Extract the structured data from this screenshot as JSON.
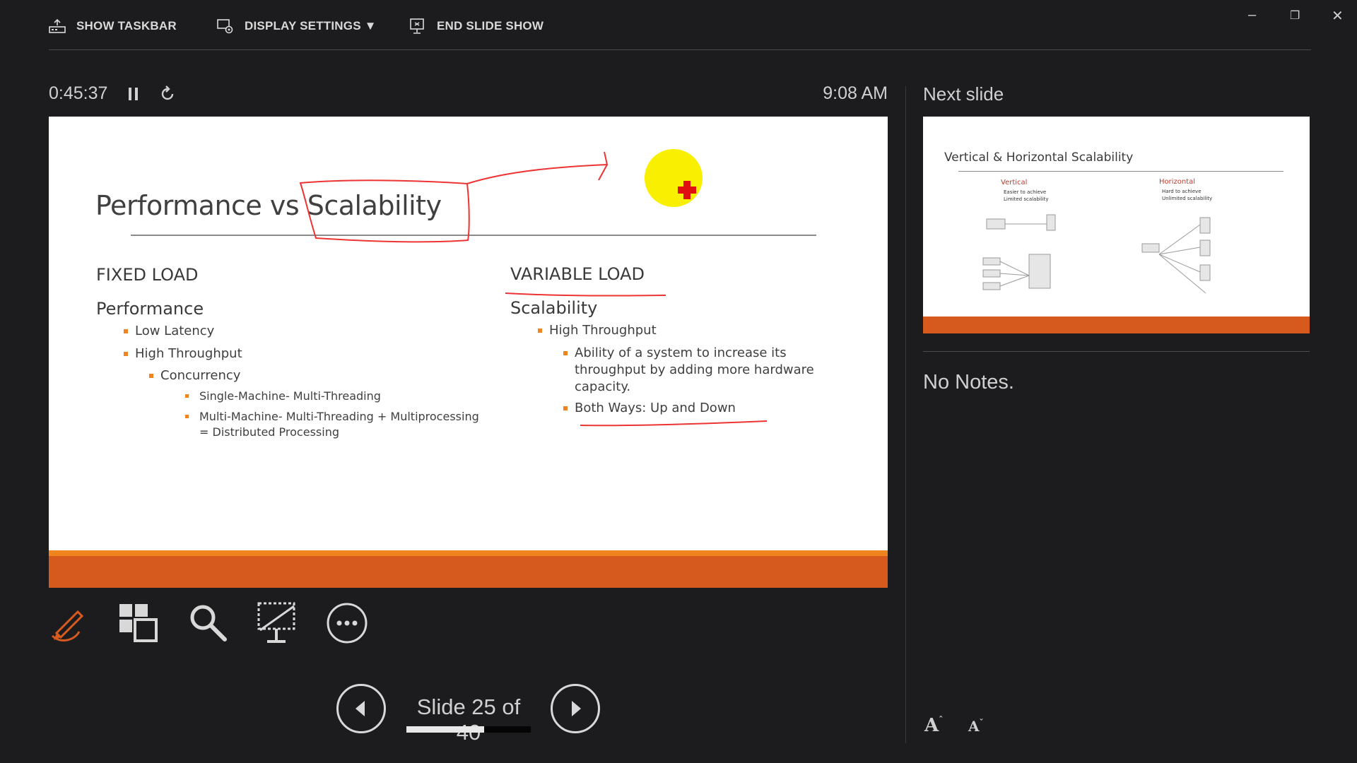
{
  "toolbar": {
    "show_taskbar": "SHOW TASKBAR",
    "display_settings": "DISPLAY SETTINGS ▼",
    "end_slide_show": "END SLIDE SHOW"
  },
  "timer": {
    "elapsed": "0:45:37",
    "clock": "9:08 AM"
  },
  "current_slide": {
    "title": "Performance vs Scalability",
    "left": {
      "heading": "FIXED LOAD",
      "subheading": "Performance",
      "items": [
        "Low Latency",
        "High Throughput"
      ],
      "sub_item": "Concurrency",
      "sub_sub_items": [
        "Single-Machine- Multi-Threading",
        "Multi-Machine- Multi-Threading + Multiprocessing",
        "= Distributed Processing"
      ]
    },
    "right": {
      "heading": "VARIABLE LOAD",
      "subheading": "Scalability",
      "item": "High Throughput",
      "sub_items": [
        "Ability of a system to increase its",
        "throughput by adding more hardware",
        "capacity.",
        "Both Ways: Up and Down"
      ]
    }
  },
  "navigation": {
    "slide_counter": "Slide 25 of 40",
    "progress": 0.625
  },
  "next_slide": {
    "label": "Next slide",
    "title": "Vertical & Horizontal Scalability",
    "vertical": {
      "heading": "Vertical",
      "bullets": [
        "Easier to achieve",
        "Limited scalability"
      ]
    },
    "horizontal": {
      "heading": "Horizontal",
      "bullets": [
        "Hard to achieve",
        "Unlimited scalability"
      ]
    }
  },
  "notes": {
    "text": "No Notes."
  },
  "font_controls": {
    "increase": "A",
    "decrease": "A"
  },
  "colors": {
    "accent": "#d65a1e",
    "bullet": "#f0841e",
    "background": "#1c1c1e"
  }
}
